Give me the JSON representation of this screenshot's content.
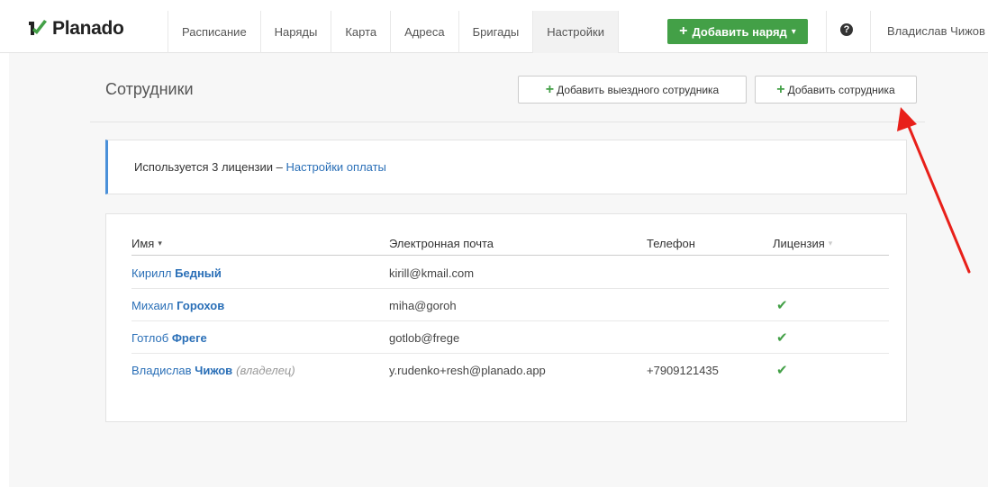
{
  "app": {
    "brand": "Planado"
  },
  "nav": {
    "items": [
      {
        "label": "Расписание"
      },
      {
        "label": "Наряды"
      },
      {
        "label": "Карта"
      },
      {
        "label": "Адреса"
      },
      {
        "label": "Бригады"
      },
      {
        "label": "Настройки",
        "active": true
      }
    ],
    "add_order": {
      "plus": "+",
      "label": "Добавить наряд",
      "caret": "▾"
    },
    "help_symbol": "?",
    "user": "Владислав Чижов"
  },
  "page": {
    "title": "Сотрудники",
    "add_field_employee": {
      "plus": "+",
      "label": "Добавить выездного сотрудника"
    },
    "add_employee": {
      "plus": "+",
      "label": "Добавить сотрудника"
    }
  },
  "license_info": {
    "text": "Используется 3 лицензии – ",
    "link": "Настройки оплаты"
  },
  "table": {
    "columns": {
      "name": "Имя",
      "email": "Электронная почта",
      "phone": "Телефон",
      "license": "Лицензия"
    },
    "sort_caret": "▾",
    "check_symbol": "✔",
    "rows": [
      {
        "first": "Кирилл",
        "last": "Бедный",
        "owner": "",
        "email": "kirill@kmail.com",
        "phone": "",
        "license": false
      },
      {
        "first": "Михаил",
        "last": "Горохов",
        "owner": "",
        "email": "miha@goroh",
        "phone": "",
        "license": true
      },
      {
        "first": "Готлоб",
        "last": "Фреге",
        "owner": "",
        "email": "gotlob@frege",
        "phone": "",
        "license": true
      },
      {
        "first": "Владислав",
        "last": "Чижов",
        "owner": "(владелец)",
        "email": "y.rudenko+resh@planado.app",
        "phone": "+7909121435",
        "license": true
      }
    ]
  },
  "colors": {
    "primary_green": "#43a047",
    "link_blue": "#2a6fb7",
    "info_border": "#4a90d9",
    "arrow_red": "#e8201a"
  },
  "icons": {
    "logo": "planado-check-logo",
    "help": "question-circle-icon",
    "check": "check-icon",
    "arrow": "red-annotation-arrow"
  }
}
